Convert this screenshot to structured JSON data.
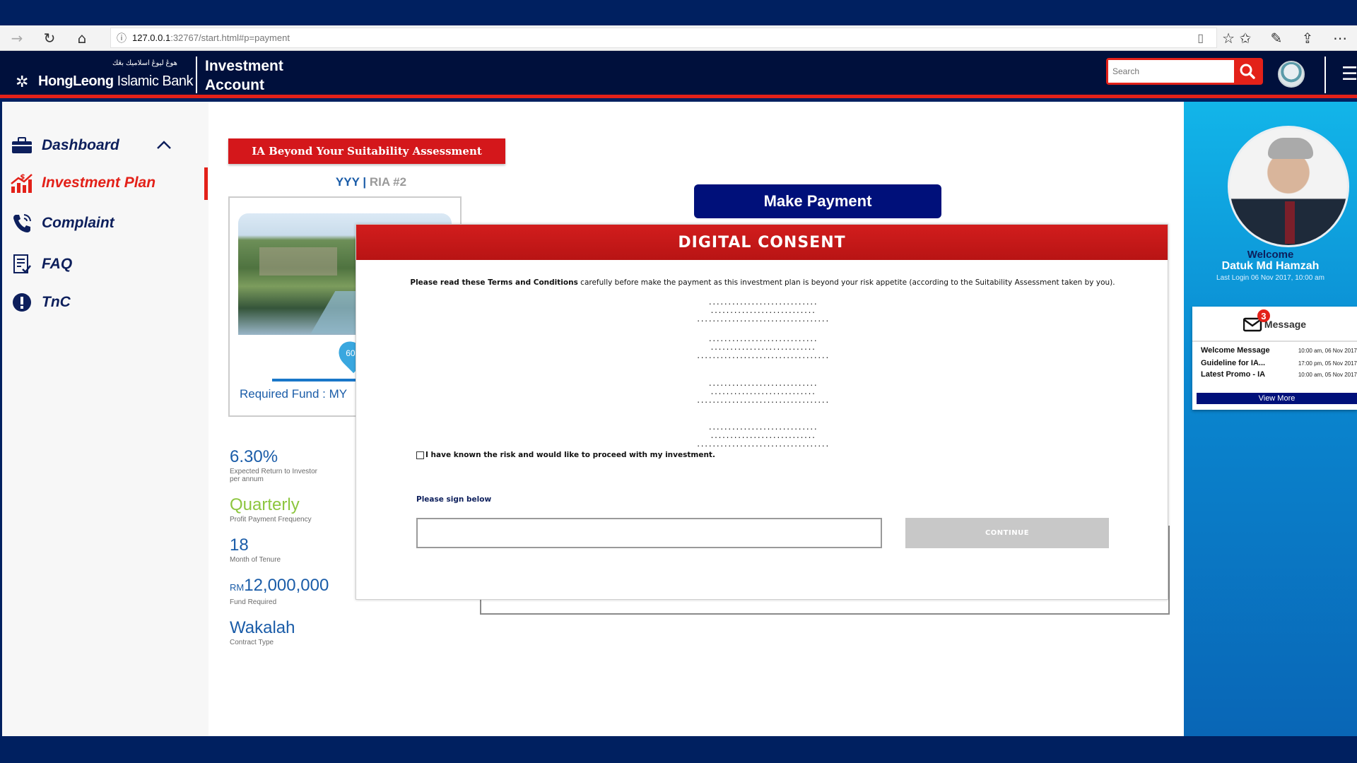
{
  "browser": {
    "url_host": "127.0.0.1",
    "url_path": ":32767/start.html#p=payment"
  },
  "header": {
    "arabic_tagline": "هوڠ ليوڠ اسلاميك بڠك",
    "bank_name_bold": "HongLeong",
    "bank_name_rest": " Islamic Bank",
    "app_title_line1": "Investment",
    "app_title_line2": "Account",
    "search_placeholder": "Search"
  },
  "sidebar": {
    "items": [
      {
        "label": "Dashboard",
        "icon": "briefcase-icon"
      },
      {
        "label": "Investment Plan",
        "icon": "growth-chart-icon",
        "active": true
      },
      {
        "label": "Complaint",
        "icon": "phone-icon"
      },
      {
        "label": "FAQ",
        "icon": "checklist-icon"
      },
      {
        "label": "TnC",
        "icon": "exclamation-icon"
      }
    ]
  },
  "plan": {
    "badge": "IA Beyond Your Suitability Assessment",
    "code": "YYY",
    "separator": " | ",
    "ria": "RIA #2",
    "pin_label": "60",
    "required_fund": "Required Fund : MY",
    "stats": [
      {
        "value": "6.30%",
        "label": "Expected Return to Investor per annum"
      },
      {
        "value": "Quarterly",
        "label": "Profit Payment Frequency"
      },
      {
        "value": "18",
        "label": "Month of Tenure"
      },
      {
        "currency": "RM",
        "value": "12,000,000",
        "label": "Fund Required"
      },
      {
        "value": "Wakalah",
        "label": "Contract Type"
      }
    ]
  },
  "make_payment_label": "Make Payment",
  "modal": {
    "title": "DIGITAL CONSENT",
    "terms_bold": "Please read these Terms and Conditions",
    "terms_rest": " carefully before make the payment as this investment plan is beyond your risk appetite (according to the Suitability Assessment taken by you).",
    "dots_short": "............................",
    "dots_mid": "...........................",
    "dots_long": "..................................",
    "consent_label": "I have known the risk and would like to proceed with my investment.",
    "sign_label": "Please sign below",
    "continue_label": "CONTINUE"
  },
  "profile": {
    "welcome": "Welcome",
    "name": "Datuk Md Hamzah",
    "last_login": "Last Login 06 Nov 2017, 10:00 am"
  },
  "messages": {
    "title": "Message",
    "unread_count": "3",
    "items": [
      {
        "subject": "Welcome Message",
        "time": "10:00 am, 06 Nov 2017"
      },
      {
        "subject": "Guideline for IA...",
        "time": "17:00 pm, 05 Nov 2017"
      },
      {
        "subject": "Latest Promo - IA",
        "time": "10:00 am, 05 Nov 2017"
      }
    ],
    "view_more": "View More"
  },
  "colors": {
    "brand_navy": "#00103c",
    "accent_red": "#e32119",
    "button_navy": "#00107a",
    "panel_blue": "#0a86cf"
  }
}
